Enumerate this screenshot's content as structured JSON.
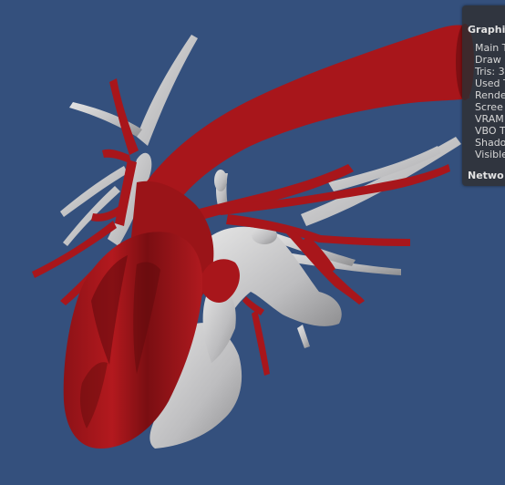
{
  "scene": {
    "background_color": "#34507d",
    "artery_color": "#a8161b",
    "artery_shade": "#5e0a0c",
    "vein_color": "#d4d4d4",
    "vein_shade": "#8d8d8f"
  },
  "stats_panel": {
    "title": "Graphi",
    "lines": [
      "Main T",
      "Draw",
      "Tris: 3",
      "Used T",
      "Rende",
      "Scree",
      "VRAM",
      "VBO T",
      "Shado",
      "Visible"
    ],
    "network_label": "Netwo"
  }
}
